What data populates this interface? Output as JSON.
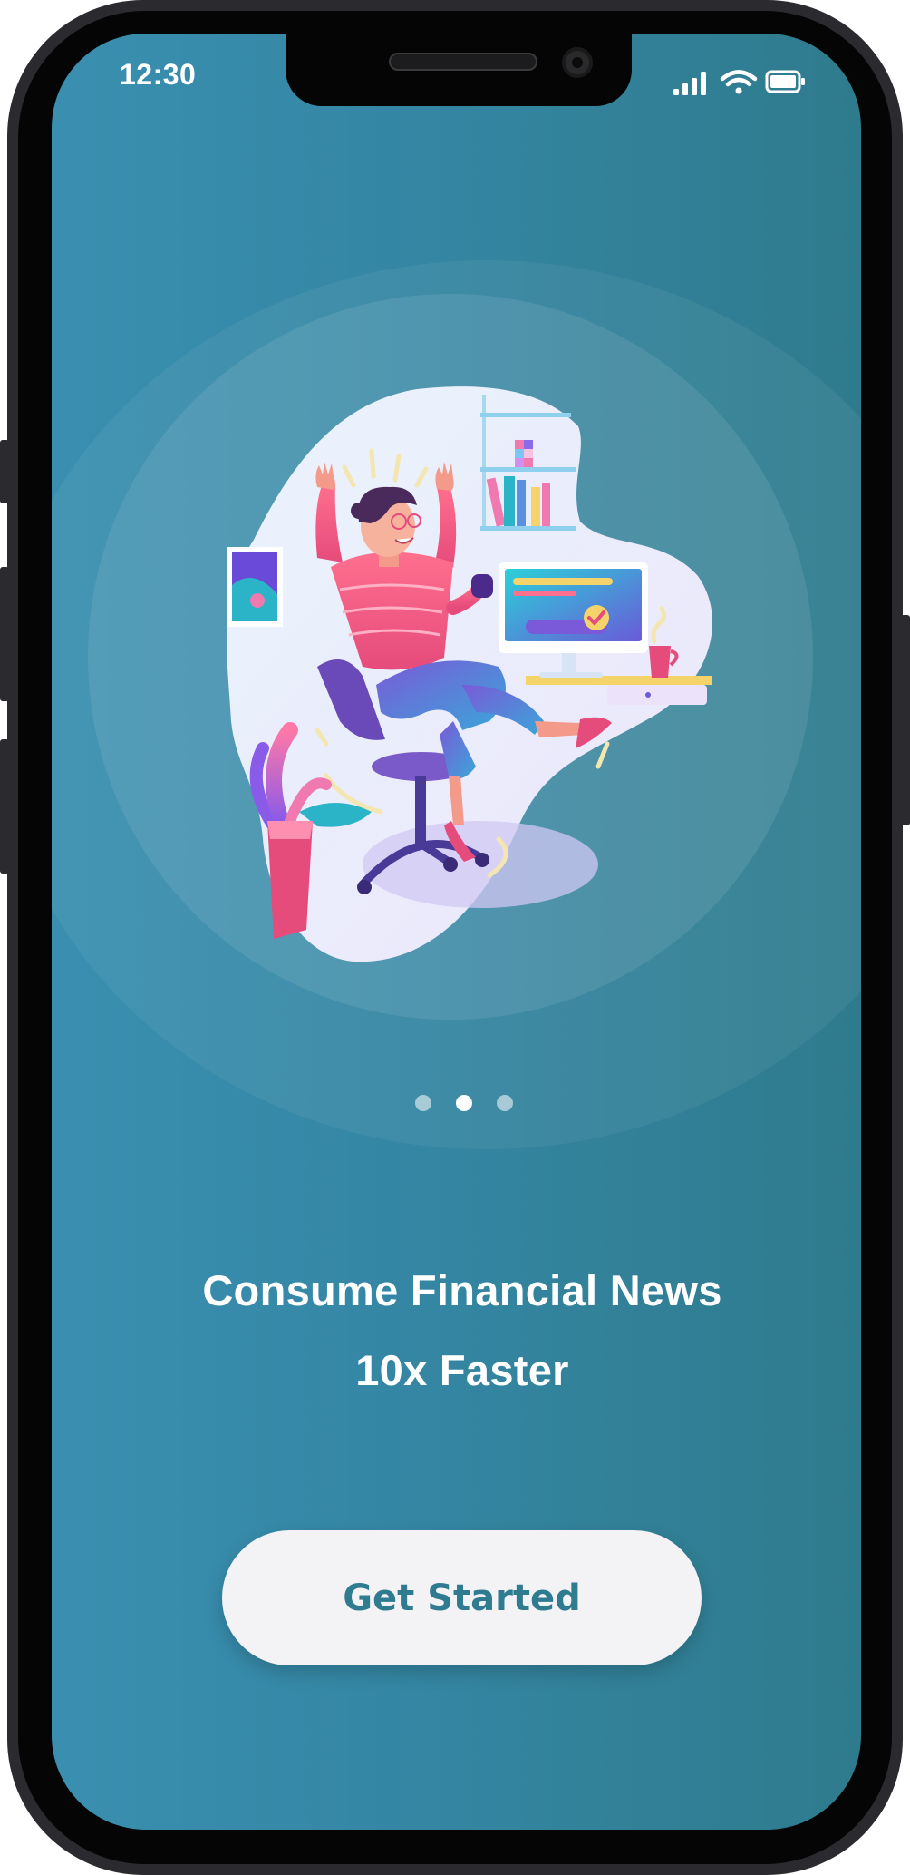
{
  "status_bar": {
    "time": "12:30",
    "icons": [
      "cellular-signal-icon",
      "wifi-icon",
      "battery-icon"
    ]
  },
  "onboarding": {
    "illustration": "person-celebrating-at-desk-illustration",
    "pagination": {
      "total": 3,
      "active_index": 1
    },
    "headline_line1": "Consume Financial News",
    "headline_line2": "10x Faster",
    "cta_label": "Get Started"
  },
  "colors": {
    "background_start": "#3a8fb0",
    "background_end": "#2f7b8d",
    "button_background": "#f3f3f6",
    "button_text": "#2f7b8f"
  }
}
